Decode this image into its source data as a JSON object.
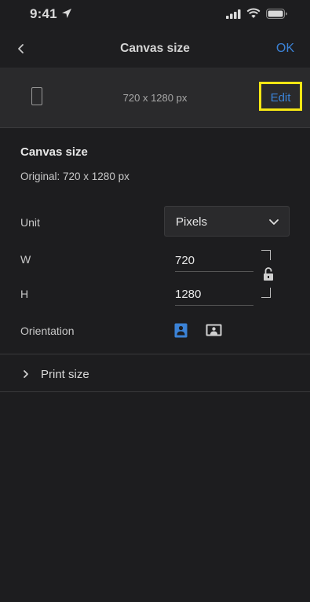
{
  "status_bar": {
    "time": "9:41"
  },
  "nav": {
    "title": "Canvas size",
    "ok_label": "OK"
  },
  "summary": {
    "dimensions": "720 x 1280 px",
    "edit_label": "Edit"
  },
  "canvas": {
    "section_title": "Canvas size",
    "original": "Original: 720 x 1280 px",
    "unit_label": "Unit",
    "unit_value": "Pixels",
    "width_label": "W",
    "width_value": "720",
    "height_label": "H",
    "height_value": "1280",
    "orientation_label": "Orientation",
    "orientation_selected": "portrait"
  },
  "print": {
    "label": "Print size"
  },
  "colors": {
    "accent": "#3b82d6",
    "highlight": "#f5e614",
    "background": "#1d1d1f"
  },
  "icons": [
    "location-icon",
    "signal-icon",
    "wifi-icon",
    "battery-icon",
    "back-chevron-icon",
    "phone-icon",
    "chevron-down-icon",
    "lock-icon",
    "portrait-icon",
    "landscape-icon",
    "chevron-right-icon"
  ]
}
